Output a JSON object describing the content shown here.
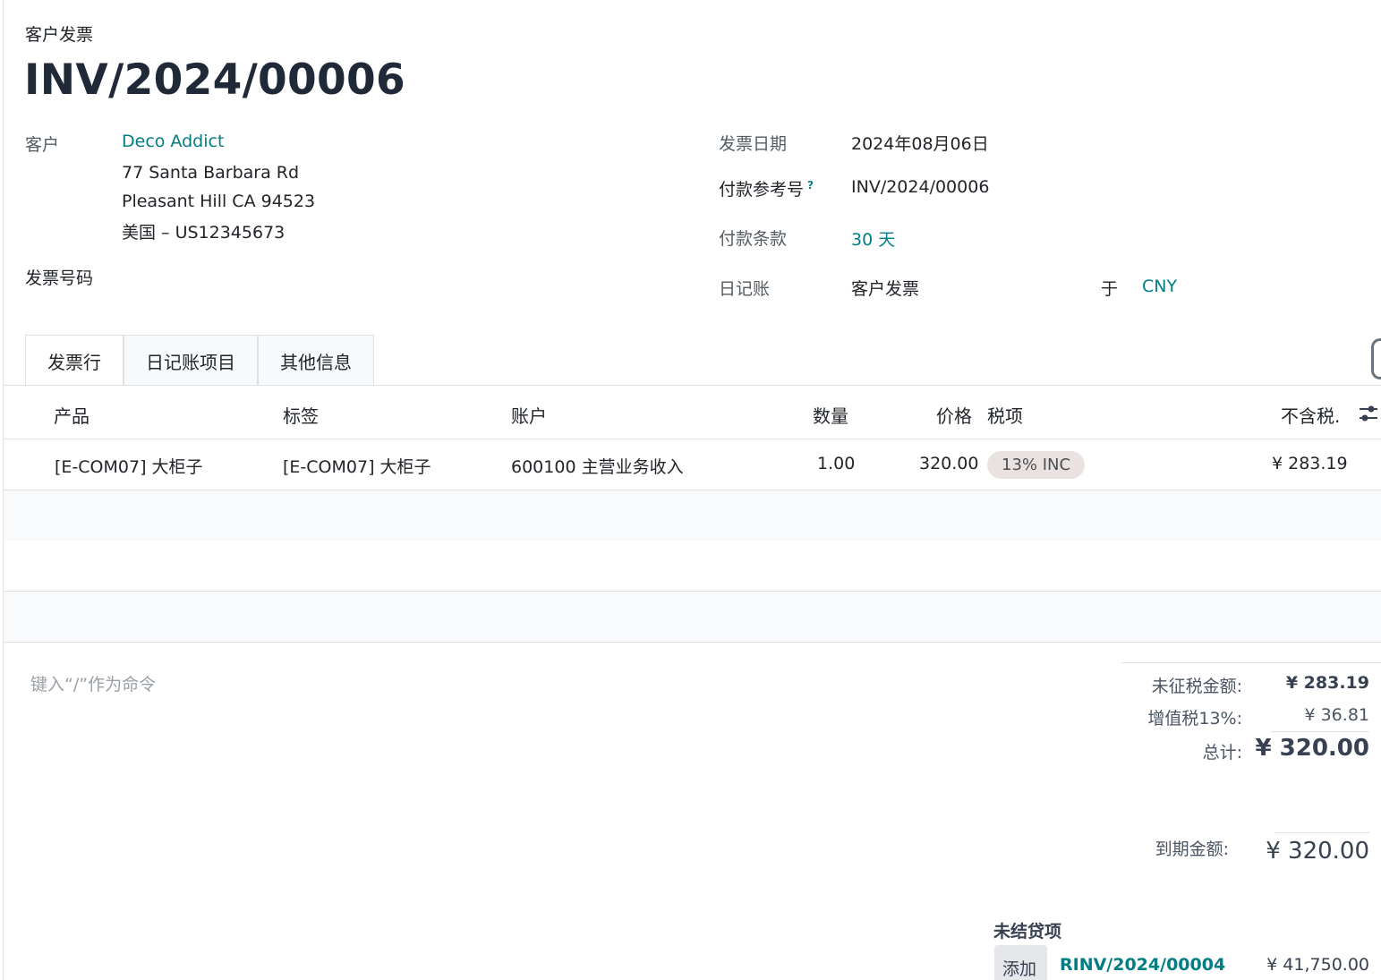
{
  "header": {
    "doc_type": "客户发票",
    "title": "INV/2024/00006"
  },
  "customer": {
    "label": "客户",
    "name": "Deco Addict",
    "address_lines": [
      "77 Santa Barbara Rd",
      "Pleasant Hill CA 94523",
      "美国 – US12345673"
    ]
  },
  "invoice_number_label": "发票号码",
  "info": {
    "invoice_date_label": "发票日期",
    "invoice_date": "2024年08月06日",
    "payment_ref_label": "付款参考号",
    "payment_ref_help": "?",
    "payment_ref": "INV/2024/00006",
    "payment_terms_label": "付款条款",
    "payment_terms": "30 天",
    "journal_label": "日记账",
    "journal": "客户发票",
    "currency_prefix": "于",
    "currency": "CNY"
  },
  "tabs": [
    {
      "label": "发票行",
      "active": true
    },
    {
      "label": "日记账项目",
      "active": false
    },
    {
      "label": "其他信息",
      "active": false
    }
  ],
  "table": {
    "columns": [
      "产品",
      "标签",
      "账户",
      "数量",
      "价格",
      "税项",
      "不含税."
    ],
    "rows": [
      {
        "product": "[E-COM07] 大柜子",
        "label": "[E-COM07] 大柜子",
        "account": "600100 主营业务收入",
        "quantity": "1.00",
        "price": "320.00",
        "tax": "13% INC",
        "subtotal": "¥ 283.19"
      }
    ],
    "command_hint": "键入“/”作为命令"
  },
  "totals": {
    "untaxed_label": "未征税金额:",
    "untaxed_value": "¥ 283.19",
    "vat_label": "增值税13%:",
    "vat_value": "¥ 36.81",
    "total_label": "总计:",
    "total_value": "¥ 320.00",
    "due_label": "到期金额:",
    "due_value": "¥ 320.00"
  },
  "outstanding": {
    "title": "未结贷项",
    "add_label": "添加",
    "reference": "RINV/2024/00004",
    "amount": "¥ 41,750.00"
  },
  "colors": {
    "link": "#017e84",
    "tax_badge_bg": "#e9e2e0",
    "empty_row_bg": "#f9fafb"
  }
}
